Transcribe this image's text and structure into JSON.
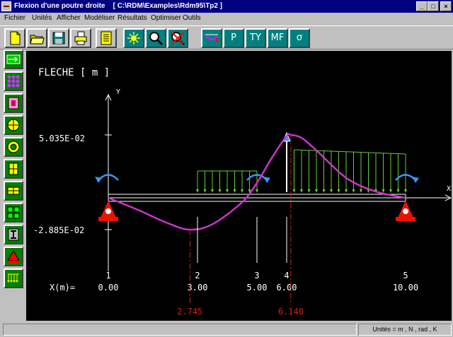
{
  "window": {
    "title": "Flexion d'une poutre droite    [ C:\\RDM\\Examples\\Rdm95\\Tp2 ]",
    "min_label": "_",
    "max_label": "□",
    "close_label": "×"
  },
  "menu": [
    "Fichier",
    "Unités",
    "Afficher",
    "Modéliser",
    "Résultats",
    "Optimiser",
    "Outils"
  ],
  "toolbar": {
    "file_icons": [
      "new-file-icon",
      "open-folder-icon",
      "save-disk-icon",
      "print-icon",
      "notes-icon"
    ],
    "view_icons": [
      "sun-icon",
      "zoom-icon",
      "no-zoom-icon"
    ],
    "result_buttons": [
      "P",
      "TY",
      "MF",
      "σ"
    ],
    "result_first_icon": "deformed-beam-icon"
  },
  "sidebar": [
    "beam-definition-icon",
    "nodes-icon",
    "section-icon",
    "circle-section-icon",
    "ring-section-icon",
    "rect-section-icon",
    "ibeam-section-icon",
    "grid-section-icon",
    "support-icon",
    "load-icon",
    "distributed-load-icon"
  ],
  "plot": {
    "title": "FLECHE [ m ]",
    "y_axis_label": "Y",
    "x_axis_label": "X",
    "x_row_label": "X(m)=",
    "y_max_label": "5.035E-02",
    "y_min_label": "-2.885E-02",
    "nodes": [
      {
        "id": "1",
        "x_label": "0.00"
      },
      {
        "id": "2",
        "x_label": "3.00"
      },
      {
        "id": "3",
        "x_label": "5.00"
      },
      {
        "id": "4",
        "x_label": "6.00"
      },
      {
        "id": "5",
        "x_label": "10.00"
      }
    ],
    "extrema_x_labels": [
      "2.745",
      "6.140"
    ],
    "colors": {
      "curve": "#cc33cc",
      "loads": "#66cc33",
      "support": "#ee1100",
      "arrows": "#3399ff",
      "extrema": "#cc2222",
      "text": "#ffffff"
    }
  },
  "chart_data": {
    "type": "line",
    "title": "FLECHE [ m ]",
    "xlabel": "X(m)",
    "ylabel": "Y",
    "ylim": [
      -0.02885,
      0.05035
    ],
    "x": [
      0,
      1,
      2,
      2.745,
      3.5,
      4.5,
      5,
      5.5,
      6,
      6.14,
      6.5,
      7,
      8,
      9,
      10
    ],
    "y": [
      0,
      -0.011,
      -0.023,
      -0.02885,
      -0.024,
      -0.004,
      0.012,
      0.032,
      0.0495,
      0.05035,
      0.048,
      0.038,
      0.016,
      0.005,
      0
    ],
    "support_x": [
      0,
      10
    ],
    "node_x": [
      0,
      3,
      5,
      6,
      10
    ],
    "extrema": [
      {
        "x": 2.745,
        "y": -0.02885
      },
      {
        "x": 6.14,
        "y": 0.05035
      }
    ]
  },
  "status": {
    "units": "Unités = m , N , rad , K"
  }
}
